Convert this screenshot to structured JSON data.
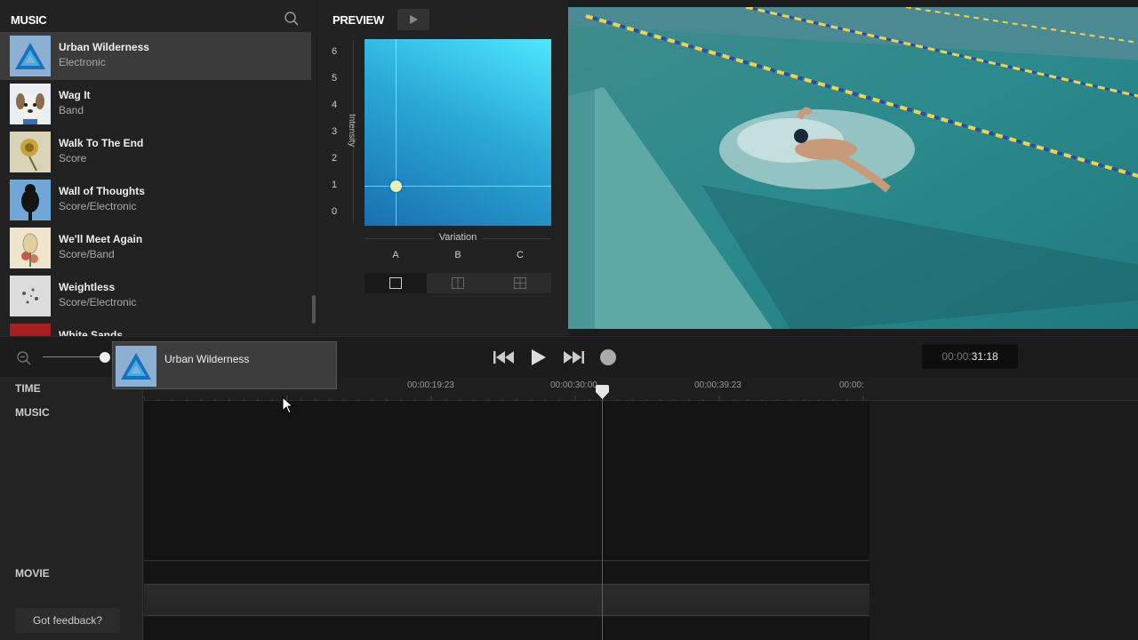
{
  "music_panel": {
    "title": "MUSIC",
    "search_icon": "search-icon",
    "tracks": [
      {
        "name": "Urban Wilderness",
        "genre": "Electronic",
        "selected": true
      },
      {
        "name": "Wag It",
        "genre": "Band"
      },
      {
        "name": "Walk To The End",
        "genre": "Score"
      },
      {
        "name": "Wall of Thoughts",
        "genre": "Score/Electronic"
      },
      {
        "name": "We'll Meet Again",
        "genre": "Score/Band"
      },
      {
        "name": "Weightless",
        "genre": "Score/Electronic"
      },
      {
        "name": "White Sands",
        "genre": ""
      }
    ]
  },
  "preview": {
    "title": "PREVIEW",
    "y_ticks": [
      "6",
      "5",
      "4",
      "3",
      "2",
      "1",
      "0"
    ],
    "y_label": "Intensity",
    "x_label": "Variation",
    "x_ticks": [
      "A",
      "B",
      "C"
    ],
    "intensity_value": 1,
    "variation_value": "A",
    "layout_options": [
      "single",
      "split",
      "grid"
    ],
    "active_layout": "single"
  },
  "transport": {
    "zoom_icon": "zoom-out-icon",
    "timecode_dim": "00:00:",
    "timecode_bright": "31:18"
  },
  "timeline": {
    "time_label": "TIME",
    "music_label": "MUSIC",
    "movie_label": "MOVIE",
    "feedback_label": "Got feedback?",
    "ruler_labels": [
      "00:00:19:23",
      "00:00:30:00",
      "00:00:39:23",
      "00:00:"
    ]
  },
  "drag_ghost": {
    "name": "Urban Wilderness"
  },
  "colors": {
    "accent_pad_top": "#4de7ff",
    "accent_pad_bottom": "#1a6fb0",
    "playhead": "#d03030"
  }
}
